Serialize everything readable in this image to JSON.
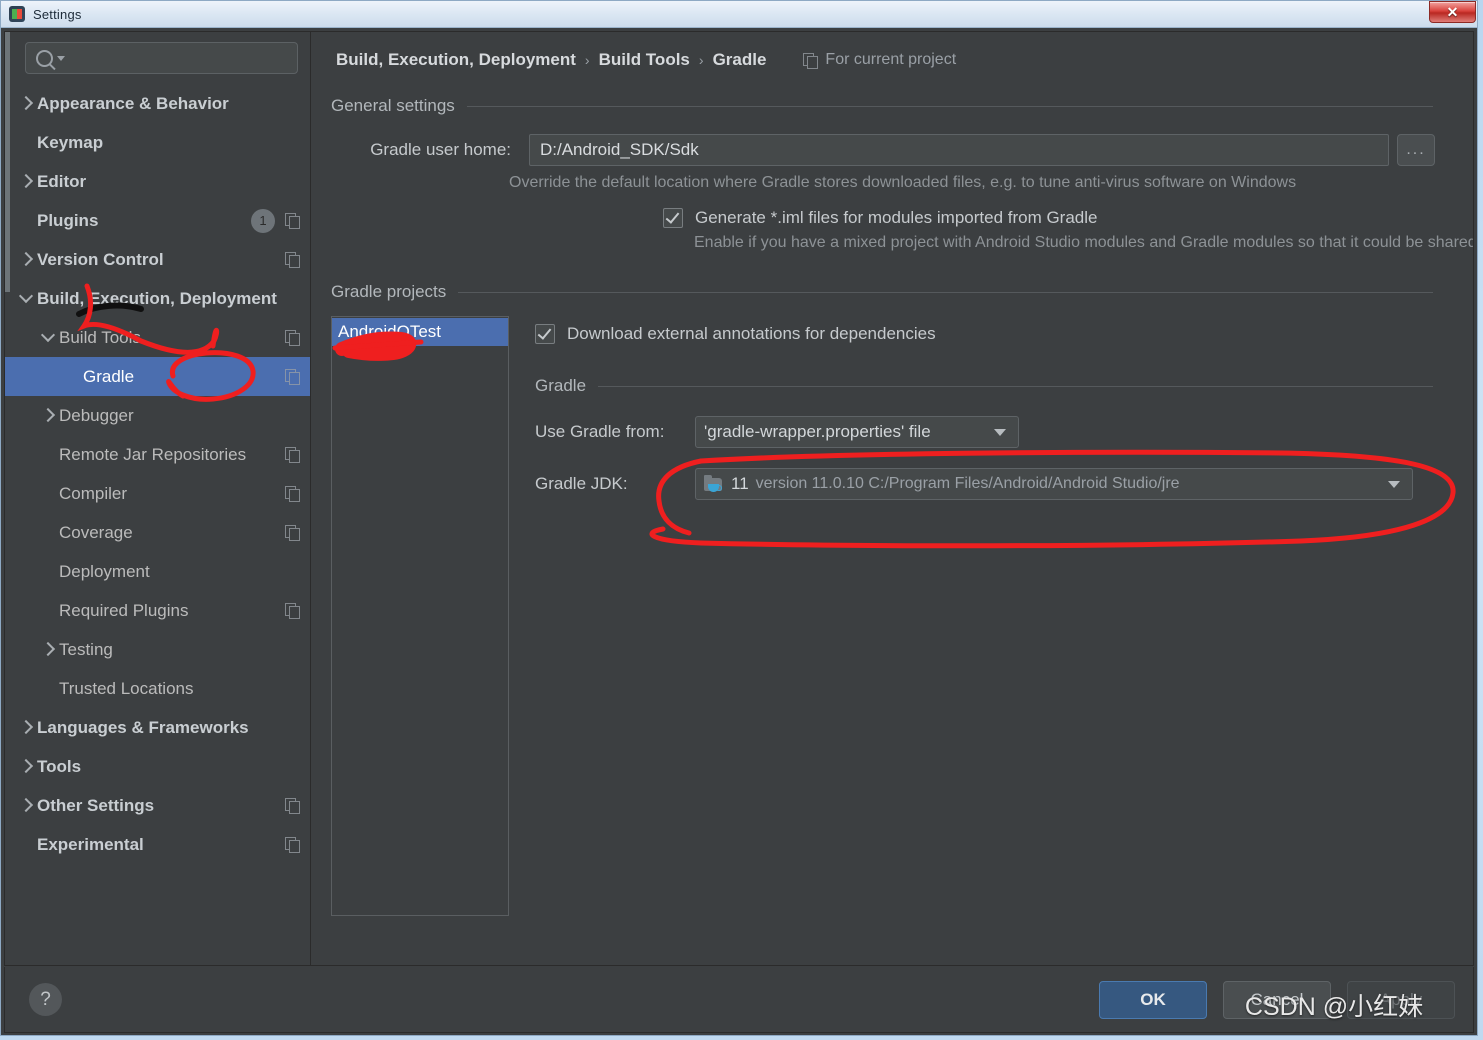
{
  "window": {
    "title": "Settings",
    "app_icon": "android-studio-icon",
    "close_label": "✕"
  },
  "sidebar": {
    "search": {
      "placeholder": "",
      "value": "",
      "icon": "search-icon"
    },
    "items": [
      {
        "label": "Appearance & Behavior",
        "level": 0,
        "twisty": "right",
        "bold": true,
        "badge": null,
        "copy": false,
        "selected": false
      },
      {
        "label": "Keymap",
        "level": 0,
        "twisty": "none",
        "bold": true,
        "badge": null,
        "copy": false,
        "selected": false
      },
      {
        "label": "Editor",
        "level": 0,
        "twisty": "right",
        "bold": true,
        "badge": null,
        "copy": false,
        "selected": false
      },
      {
        "label": "Plugins",
        "level": 0,
        "twisty": "none",
        "bold": true,
        "badge": "1",
        "copy": true,
        "selected": false
      },
      {
        "label": "Version Control",
        "level": 0,
        "twisty": "right",
        "bold": true,
        "badge": null,
        "copy": true,
        "selected": false
      },
      {
        "label": "Build, Execution, Deployment",
        "level": 0,
        "twisty": "down",
        "bold": true,
        "badge": null,
        "copy": false,
        "selected": false
      },
      {
        "label": "Build Tools",
        "level": 1,
        "twisty": "down",
        "bold": false,
        "badge": null,
        "copy": true,
        "selected": false
      },
      {
        "label": "Gradle",
        "level": 2,
        "twisty": "none",
        "bold": false,
        "badge": null,
        "copy": true,
        "selected": true
      },
      {
        "label": "Debugger",
        "level": 1,
        "twisty": "right",
        "bold": false,
        "badge": null,
        "copy": false,
        "selected": false
      },
      {
        "label": "Remote Jar Repositories",
        "level": 1,
        "twisty": "none",
        "bold": false,
        "badge": null,
        "copy": true,
        "selected": false
      },
      {
        "label": "Compiler",
        "level": 1,
        "twisty": "none",
        "bold": false,
        "badge": null,
        "copy": true,
        "selected": false
      },
      {
        "label": "Coverage",
        "level": 1,
        "twisty": "none",
        "bold": false,
        "badge": null,
        "copy": true,
        "selected": false
      },
      {
        "label": "Deployment",
        "level": 1,
        "twisty": "none",
        "bold": false,
        "badge": null,
        "copy": false,
        "selected": false
      },
      {
        "label": "Required Plugins",
        "level": 1,
        "twisty": "none",
        "bold": false,
        "badge": null,
        "copy": true,
        "selected": false
      },
      {
        "label": "Testing",
        "level": 1,
        "twisty": "right",
        "bold": false,
        "badge": null,
        "copy": false,
        "selected": false
      },
      {
        "label": "Trusted Locations",
        "level": 1,
        "twisty": "none",
        "bold": false,
        "badge": null,
        "copy": false,
        "selected": false
      },
      {
        "label": "Languages & Frameworks",
        "level": 0,
        "twisty": "right",
        "bold": true,
        "badge": null,
        "copy": false,
        "selected": false
      },
      {
        "label": "Tools",
        "level": 0,
        "twisty": "right",
        "bold": true,
        "badge": null,
        "copy": false,
        "selected": false
      },
      {
        "label": "Other Settings",
        "level": 0,
        "twisty": "right",
        "bold": true,
        "badge": null,
        "copy": true,
        "selected": false
      },
      {
        "label": "Experimental",
        "level": 0,
        "twisty": "none",
        "bold": true,
        "badge": null,
        "copy": true,
        "selected": false
      }
    ]
  },
  "breadcrumb": {
    "part1": "Build, Execution, Deployment",
    "part2": "Build Tools",
    "part3": "Gradle",
    "separator": "›",
    "for_current_project": "For current project",
    "for_current_project_icon": "copy-icon"
  },
  "general_settings": {
    "section_title": "General settings",
    "gradle_user_home_label": "Gradle user home:",
    "gradle_user_home_value": "D:/Android_SDK/Sdk",
    "browse_label": "...",
    "gradle_user_home_hint": "Override the default location where Gradle stores downloaded files, e.g. to tune anti-virus software on Windows",
    "generate_iml_label": "Generate *.iml files for modules imported from Gradle",
    "generate_iml_checked": true,
    "generate_iml_hint": "Enable if you have a mixed project with Android Studio modules and Gradle modules so that it could be shared via VCS"
  },
  "gradle_projects": {
    "section_title": "Gradle projects",
    "project_list": [
      {
        "name": "AndroidQTest",
        "selected": true
      }
    ],
    "download_annotations_label": "Download external annotations for dependencies",
    "download_annotations_checked": true,
    "gradle_sub_section": "Gradle",
    "use_gradle_from_label": "Use Gradle from:",
    "use_gradle_from_value": "'gradle-wrapper.properties' file",
    "gradle_jdk_label": "Gradle JDK:",
    "gradle_jdk_version": "11",
    "gradle_jdk_detail": "version 11.0.10 C:/Program Files/Android/Android Studio/jre",
    "gradle_jdk_icon": "jdk-folder-icon"
  },
  "footer": {
    "help_label": "?",
    "ok_label": "OK",
    "cancel_label": "Cancel",
    "apply_label": "Apply"
  },
  "watermark": "CSDN @小红妹",
  "colors": {
    "accent_selection": "#4b6eaf",
    "ok_button": "#365880",
    "panel_bg": "#3c3f41",
    "input_bg": "#45494a",
    "annotation_red": "#ef1f1f",
    "annotation_black": "#101010"
  }
}
